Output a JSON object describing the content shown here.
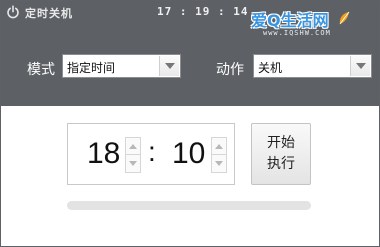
{
  "titlebar": {
    "title": "定时关机",
    "clock": "17 : 19 : 14",
    "icon": "power-icon"
  },
  "watermark": {
    "main": "爱Q生活网",
    "sub": "www.IQSHW.COM"
  },
  "settings": {
    "mode_label": "模式",
    "mode_value": "指定时间",
    "action_label": "动作",
    "action_value": "关机"
  },
  "timer": {
    "hour": "18",
    "separator": ":",
    "minute": "10"
  },
  "start_button": {
    "line1": "开始",
    "line2": "执行"
  },
  "progress": {
    "fraction": 0
  },
  "colors": {
    "header_bg": "#5d6166",
    "accent": "#3a95e0"
  }
}
